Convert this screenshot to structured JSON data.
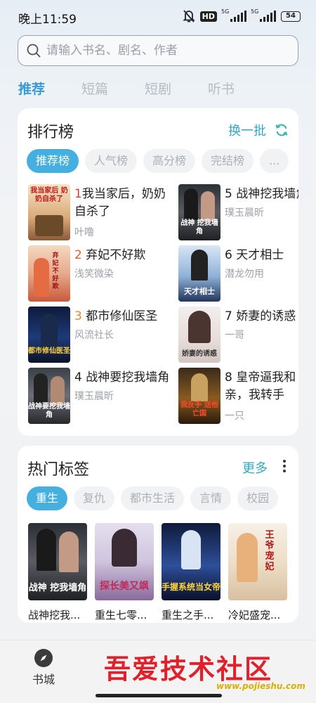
{
  "status": {
    "time": "晚上11:59",
    "hd": "HD",
    "network1": "5G",
    "network2": "5G",
    "battery": "54"
  },
  "search": {
    "placeholder": "请输入书名、剧名、作者"
  },
  "top_tabs": [
    {
      "label": "推荐",
      "active": true
    },
    {
      "label": "短篇",
      "active": false
    },
    {
      "label": "短剧",
      "active": false
    },
    {
      "label": "听书",
      "active": false
    }
  ],
  "ranking": {
    "title": "排行榜",
    "refresh_label": "换一批",
    "chips": [
      "推荐榜",
      "人气榜",
      "高分榜",
      "完结榜",
      "..."
    ],
    "books": [
      {
        "rank": "1",
        "title": "我当家后，奶奶自杀了",
        "author": "叶噜",
        "cover_text": "我当家后 奶奶自杀了"
      },
      {
        "rank": "2",
        "title": "弃妃不好欺",
        "author": "浅笑微染",
        "cover_text": "弃妃不好欺"
      },
      {
        "rank": "3",
        "title": "都市修仙医圣",
        "author": "风流社长",
        "cover_text": "都市修仙医圣"
      },
      {
        "rank": "4",
        "title": "战神要挖我墙角",
        "author": "璞玉晨昕",
        "cover_text": "战神要挖我墙角"
      },
      {
        "rank": "5",
        "title": "战神挖我墙角",
        "author": "璞玉晨昕",
        "cover_text": "战神 挖我墙角"
      },
      {
        "rank": "6",
        "title": "天才相士",
        "author": "潜龙勿用",
        "cover_text": "天才相士"
      },
      {
        "rank": "7",
        "title": "娇妻的诱惑",
        "author": "一哥",
        "cover_text": "娇妻的诱惑"
      },
      {
        "rank": "8",
        "title": "皇帝逼我和亲，我转手",
        "author": "一只",
        "cover_text": "我反手 送他亡国"
      }
    ]
  },
  "tags": {
    "title": "热门标签",
    "more_label": "更多",
    "chips": [
      "重生",
      "复仇",
      "都市生活",
      "言情",
      "校园"
    ],
    "books": [
      {
        "title": "战神挖我...",
        "cover_text": "战神 挖我墙角"
      },
      {
        "title": "重生七零...",
        "cover_text": "探长美又飒"
      },
      {
        "title": "重生之手...",
        "cover_text": "手握系统当女帝"
      },
      {
        "title": "冷妃盛宠...",
        "cover_text": "王爷宠妃"
      }
    ]
  },
  "bottom_nav": {
    "shelf_label": "书城"
  },
  "watermark": {
    "text": "吾爱技术社区",
    "url": "www.pojieshu.com"
  }
}
